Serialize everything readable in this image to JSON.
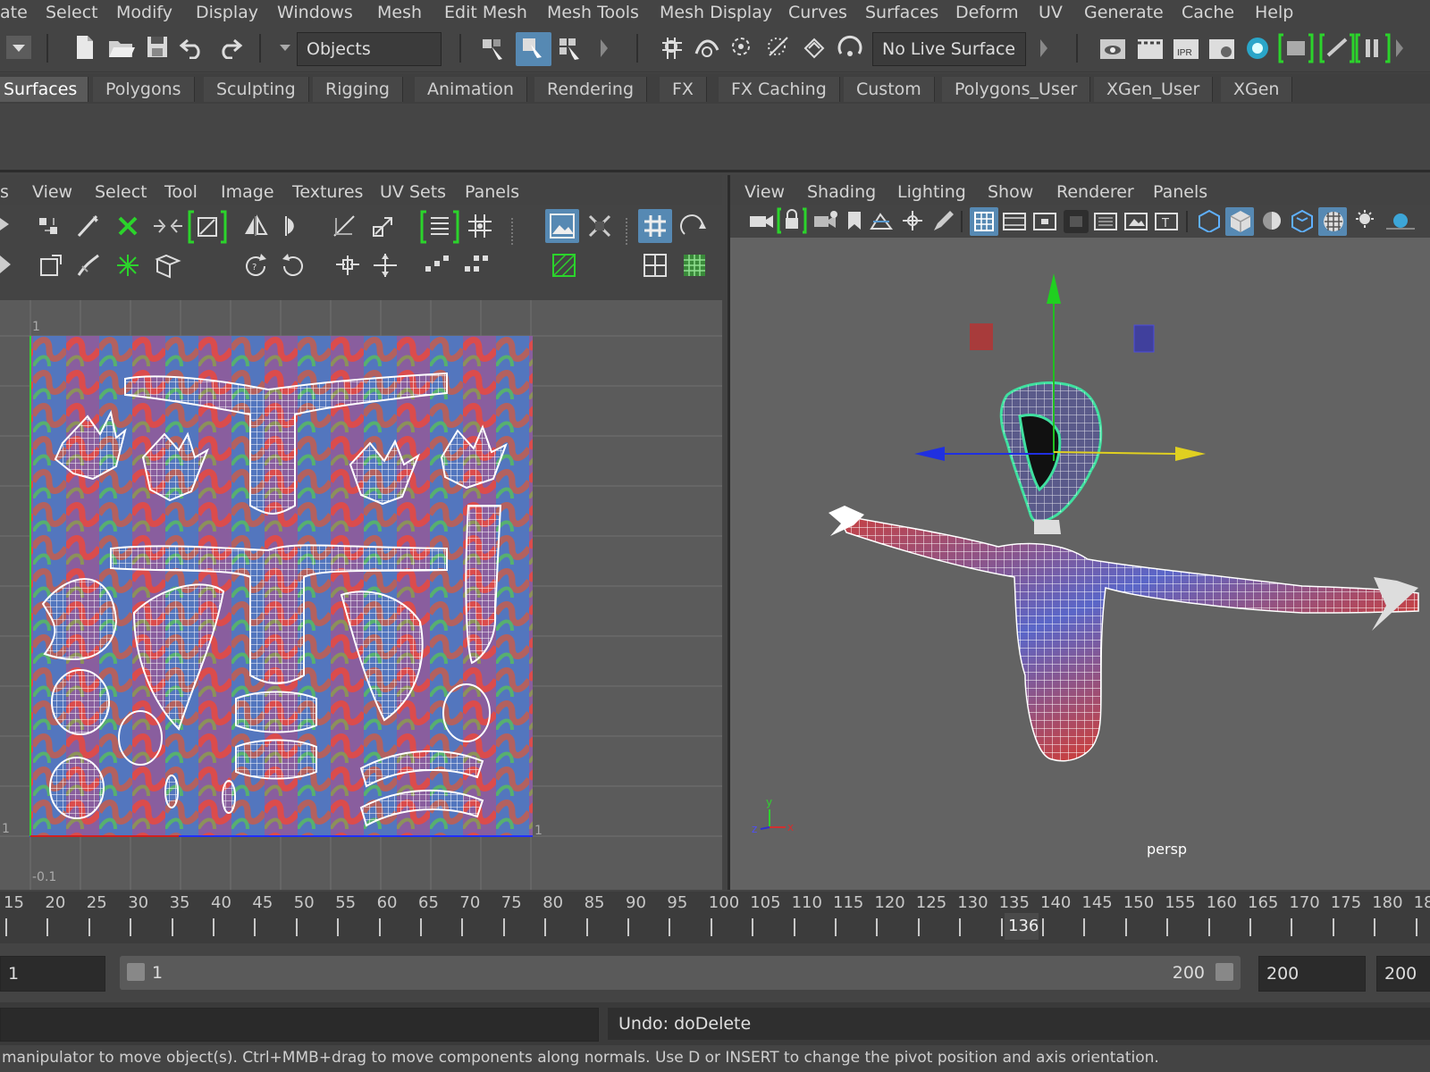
{
  "menubar": {
    "items": [
      "ate",
      "Select",
      "Modify",
      "Display",
      "Windows",
      "Mesh",
      "Edit Mesh",
      "Mesh Tools",
      "Mesh Display",
      "Curves",
      "Surfaces",
      "Deform",
      "UV",
      "Generate",
      "Cache",
      "Help"
    ]
  },
  "toolbar": {
    "objects_dropdown": "Objects",
    "live_surface": "No Live Surface"
  },
  "shelf": {
    "tabs": [
      "Surfaces",
      "Polygons",
      "Sculpting",
      "Rigging",
      "Animation",
      "Rendering",
      "FX",
      "FX Caching",
      "Custom",
      "Polygons_User",
      "XGen_User",
      "XGen"
    ],
    "active_tab": "Surfaces"
  },
  "uv_editor": {
    "menu": [
      "s",
      "View",
      "Select",
      "Tool",
      "Image",
      "Textures",
      "UV Sets",
      "Panels"
    ],
    "axis_labels": {
      "top": "1",
      "right": "1",
      "left": "1",
      "bottom": "-0.1"
    }
  },
  "viewport": {
    "menu": [
      "View",
      "Shading",
      "Lighting",
      "Show",
      "Renderer",
      "Panels"
    ],
    "camera_label": "persp",
    "axis_letters": {
      "x": "x",
      "y": "y",
      "z": "z"
    }
  },
  "timeline": {
    "ticks": [
      "15",
      "20",
      "25",
      "30",
      "35",
      "40",
      "45",
      "50",
      "55",
      "60",
      "65",
      "70",
      "75",
      "80",
      "85",
      "90",
      "95",
      "100",
      "105",
      "110",
      "115",
      "120",
      "125",
      "130",
      "135",
      "140",
      "145",
      "150",
      "155",
      "160",
      "165",
      "170",
      "175",
      "180",
      "18"
    ],
    "current_frame": "136"
  },
  "range": {
    "start": "1",
    "slider_start": "1",
    "slider_end": "200",
    "playback_end": "200",
    "anim_end": "200"
  },
  "command_line": {
    "result": "Undo: doDelete"
  },
  "help_line": {
    "text": "manipulator to move object(s). Ctrl+MMB+drag to move components along normals. Use D or INSERT to change the pivot position and axis orientation."
  },
  "colors": {
    "accent": "#5689b3",
    "highlight_green": "#2bd42b",
    "selection_cyan": "#40e0a0"
  }
}
